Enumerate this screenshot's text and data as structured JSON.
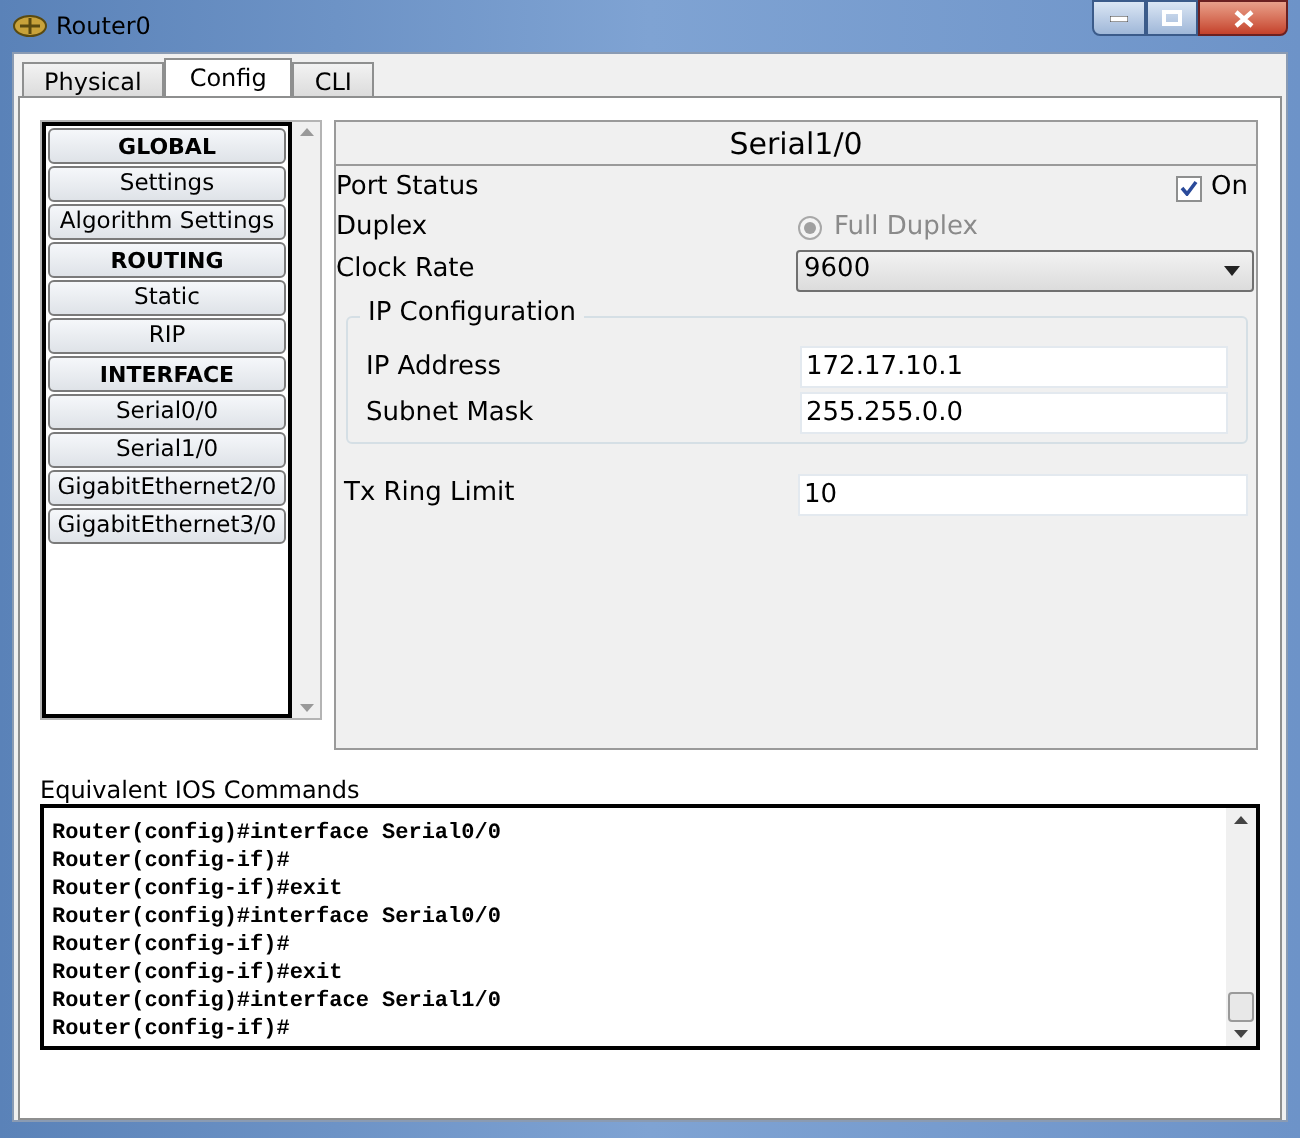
{
  "window": {
    "title": "Router0"
  },
  "tabs": [
    {
      "label": "Physical",
      "selected": false
    },
    {
      "label": "Config",
      "selected": true
    },
    {
      "label": "CLI",
      "selected": false
    }
  ],
  "sidebar": {
    "items": [
      {
        "label": "GLOBAL",
        "kind": "header"
      },
      {
        "label": "Settings",
        "kind": "item"
      },
      {
        "label": "Algorithm Settings",
        "kind": "item"
      },
      {
        "label": "ROUTING",
        "kind": "header"
      },
      {
        "label": "Static",
        "kind": "item"
      },
      {
        "label": "RIP",
        "kind": "item"
      },
      {
        "label": "INTERFACE",
        "kind": "header"
      },
      {
        "label": "Serial0/0",
        "kind": "item"
      },
      {
        "label": "Serial1/0",
        "kind": "item"
      },
      {
        "label": "GigabitEthernet2/0",
        "kind": "item"
      },
      {
        "label": "GigabitEthernet3/0",
        "kind": "item"
      }
    ]
  },
  "interface": {
    "title": "Serial1/0",
    "port_status": {
      "label": "Port Status",
      "checked": true,
      "option": "On"
    },
    "duplex": {
      "label": "Duplex",
      "option": "Full Duplex",
      "selected": true,
      "disabled": true
    },
    "clock_rate": {
      "label": "Clock Rate",
      "value": "9600"
    },
    "ip_configuration": {
      "title": "IP Configuration",
      "fields": [
        {
          "label": "IP Address",
          "value": "172.17.10.1"
        },
        {
          "label": "Subnet Mask",
          "value": "255.255.0.0"
        }
      ]
    },
    "tx_ring_limit": {
      "label": "Tx Ring Limit",
      "value": "10"
    }
  },
  "ios_commands": {
    "label": "Equivalent IOS Commands",
    "lines": [
      "Router(config)#interface Serial0/0",
      "Router(config-if)#",
      "Router(config-if)#exit",
      "Router(config)#interface Serial0/0",
      "Router(config-if)#",
      "Router(config-if)#exit",
      "Router(config)#interface Serial1/0",
      "Router(config-if)#"
    ]
  }
}
